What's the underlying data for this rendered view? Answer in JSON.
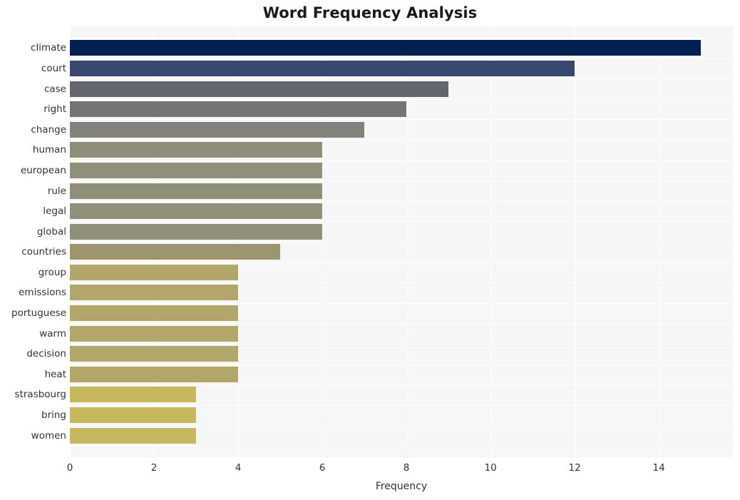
{
  "chart_data": {
    "type": "bar",
    "orientation": "horizontal",
    "title": "Word Frequency Analysis",
    "xlabel": "Frequency",
    "ylabel": "",
    "categories": [
      "climate",
      "court",
      "case",
      "right",
      "change",
      "human",
      "european",
      "rule",
      "legal",
      "global",
      "countries",
      "group",
      "emissions",
      "portuguese",
      "warm",
      "decision",
      "heat",
      "strasbourg",
      "bring",
      "women"
    ],
    "values": [
      15,
      12,
      9,
      8,
      7,
      6,
      6,
      6,
      6,
      6,
      5,
      4,
      4,
      4,
      4,
      4,
      4,
      3,
      3,
      3
    ],
    "bar_colors": [
      "#002150",
      "#3a4771",
      "#63666e",
      "#737476",
      "#838179",
      "#908d79",
      "#918e79",
      "#918e79",
      "#918e79",
      "#918e79",
      "#9c9570",
      "#b2a76a",
      "#b2a76a",
      "#b2a76a",
      "#b2a76a",
      "#b2a76a",
      "#b2a76a",
      "#c6b85e",
      "#c6b85e",
      "#c6b85e"
    ],
    "xlim": [
      0,
      15.76
    ],
    "xticks": [
      0,
      2,
      4,
      6,
      8,
      10,
      12,
      14
    ],
    "xtick_labels": [
      "0",
      "2",
      "4",
      "6",
      "8",
      "10",
      "12",
      "14"
    ],
    "grid": true,
    "grid_color": "#ffffff",
    "plot_background": "#f6f6f7",
    "figure_background": "#ffffff",
    "legend": null,
    "title_color": "#1a1a1a",
    "tick_color": "#333333"
  }
}
